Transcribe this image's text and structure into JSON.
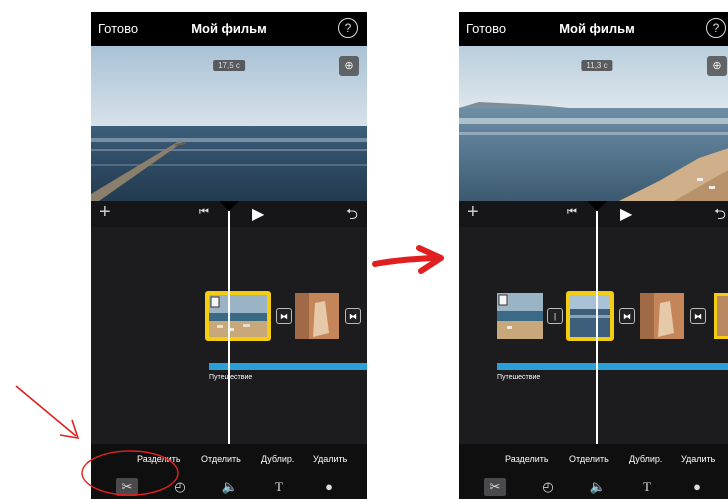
{
  "topbar": {
    "done_label": "Готово",
    "title": "Мой фильм",
    "help_label": "?"
  },
  "preview": {
    "left_duration": "17,5 с",
    "right_duration": "11,3 с"
  },
  "timeline": {
    "audio_label": "Путешествие"
  },
  "actions": {
    "split": "Разделить",
    "detach": "Отделить",
    "duplicate": "Дублир.",
    "delete": "Удалить"
  },
  "icons": {
    "scissors": "scissors-icon",
    "speed": "speedometer-icon",
    "volume": "volume-icon",
    "text": "text-icon",
    "filters": "filters-icon",
    "transition": "transition-icon"
  },
  "colors": {
    "selection": "#f4cc14",
    "audio": "#2a9fd8",
    "annotation": "#e02020"
  }
}
